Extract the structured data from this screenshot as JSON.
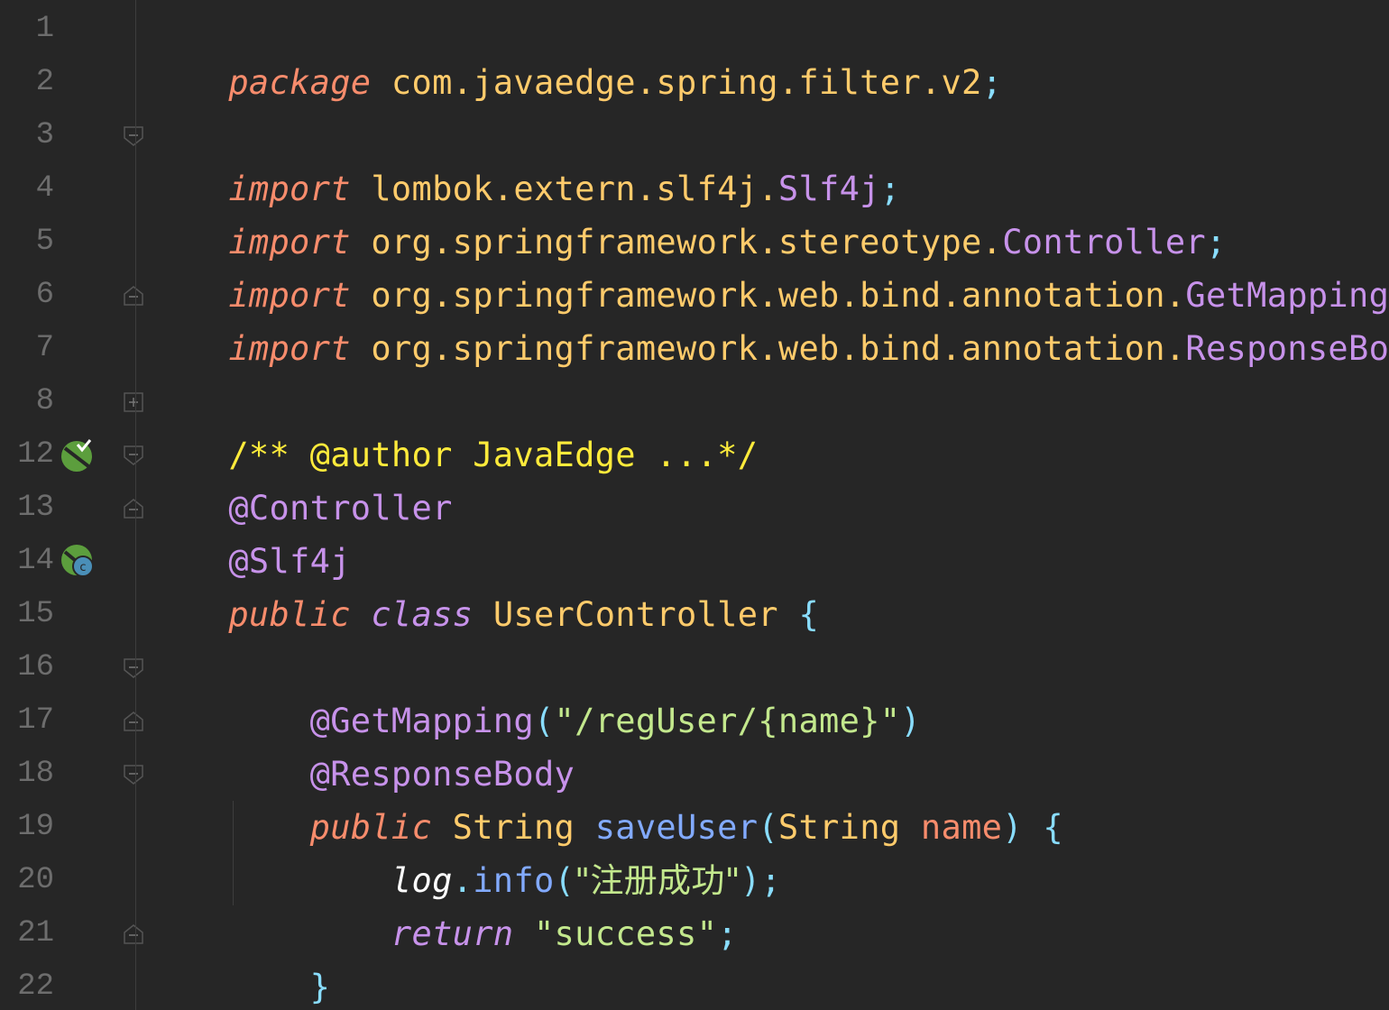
{
  "editor": {
    "line_numbers": [
      "1",
      "2",
      "3",
      "4",
      "5",
      "6",
      "7",
      "8",
      "12",
      "13",
      "14",
      "15",
      "16",
      "17",
      "18",
      "19",
      "20",
      "21",
      "22"
    ],
    "lines": {
      "l1": {
        "t1": "package",
        "t2": " com.javaedge.spring.filter.v2",
        "t3": ";"
      },
      "l3": {
        "t1": "import",
        "t2": " lombok.extern.slf4j.",
        "t3": "Slf4j",
        "t4": ";"
      },
      "l4": {
        "t1": "import",
        "t2": " org.springframework.stereotype.",
        "t3": "Controller",
        "t4": ";"
      },
      "l5": {
        "t1": "import",
        "t2": " org.springframework.web.bind.annotation.",
        "t3": "GetMapping",
        "t4": ";"
      },
      "l6": {
        "t1": "import",
        "t2": " org.springframework.web.bind.annotation.",
        "t3": "ResponseBody",
        "t4": ";"
      },
      "l8": {
        "t1": "/** @author JavaEdge ...*/"
      },
      "l12": {
        "t1": "@Controller"
      },
      "l13": {
        "t1": "@Slf4j"
      },
      "l14": {
        "t1": "public",
        "t2": " ",
        "t3": "class",
        "t4": " UserController ",
        "t5": "{"
      },
      "l16": {
        "t1": "    @GetMapping",
        "t2": "(",
        "t3": "\"/regUser/{name}\"",
        "t4": ")"
      },
      "l17": {
        "t1": "    @ResponseBody"
      },
      "l18": {
        "t1": "    ",
        "t2": "public",
        "t3": " String ",
        "t4": "saveUser",
        "t5": "(",
        "t6": "String ",
        "t7": "name",
        "t8": ") {"
      },
      "l19": {
        "t1": "        ",
        "t2": "log",
        "t3": ".",
        "t4": "info",
        "t5": "(",
        "t6": "\"注册成功\"",
        "t7": ");"
      },
      "l20": {
        "t1": "        ",
        "t2": "return",
        "t3": " ",
        "t4": "\"success\"",
        "t5": ";"
      },
      "l21": {
        "t1": "    }"
      },
      "l22": {
        "t1": "}"
      }
    },
    "gutter_icons": [
      "spring-bean-icon",
      "spring-class-icon"
    ],
    "colors": {
      "background": "#262626",
      "keyword": "#f78c6c",
      "annotation": "#c792ea",
      "package": "#ffcb6b",
      "string": "#c3e88d",
      "comment": "#ffeb3b",
      "function": "#82aaff",
      "punctuation": "#89ddff"
    }
  }
}
